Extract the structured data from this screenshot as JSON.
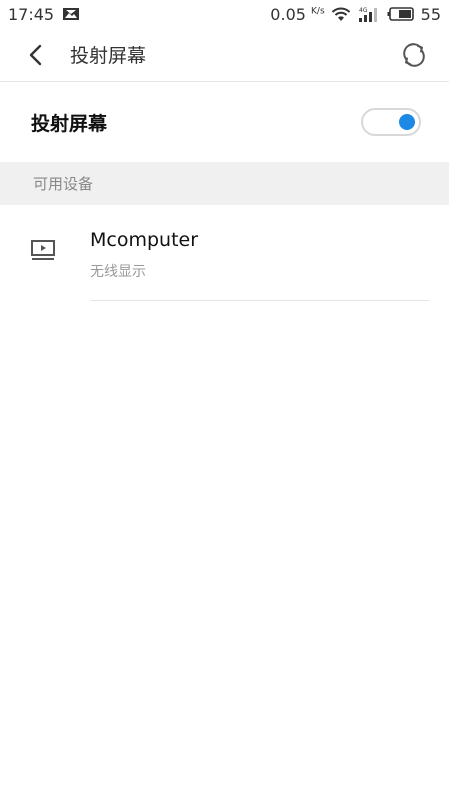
{
  "status_bar": {
    "time": "17:45",
    "net_speed": "0.05",
    "net_speed_unit": "K/s",
    "network_type": "4G",
    "battery": "55",
    "icons": [
      "image-notification-icon",
      "wifi-icon",
      "signal-icon",
      "battery-icon"
    ]
  },
  "header": {
    "title": "投射屏幕",
    "back_icon": "chevron-left-icon",
    "refresh_icon": "refresh-icon"
  },
  "cast_toggle": {
    "label": "投射屏幕",
    "on": true,
    "accent_color": "#1e88e5"
  },
  "devices_section": {
    "title": "可用设备",
    "devices": [
      {
        "name": "Mcomputer",
        "type": "无线显示",
        "icon": "monitor-play-icon"
      }
    ]
  }
}
